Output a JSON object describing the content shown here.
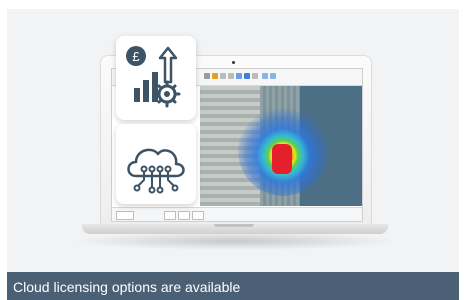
{
  "caption": "Cloud licensing options are available",
  "colors": {
    "caption_background": "#4b6075",
    "panel_background": "#f1f3f5",
    "icon_color": "#3d5366"
  },
  "icons": {
    "finance": "pound-growth-gear-icon",
    "cloud": "cloud-network-icon"
  }
}
